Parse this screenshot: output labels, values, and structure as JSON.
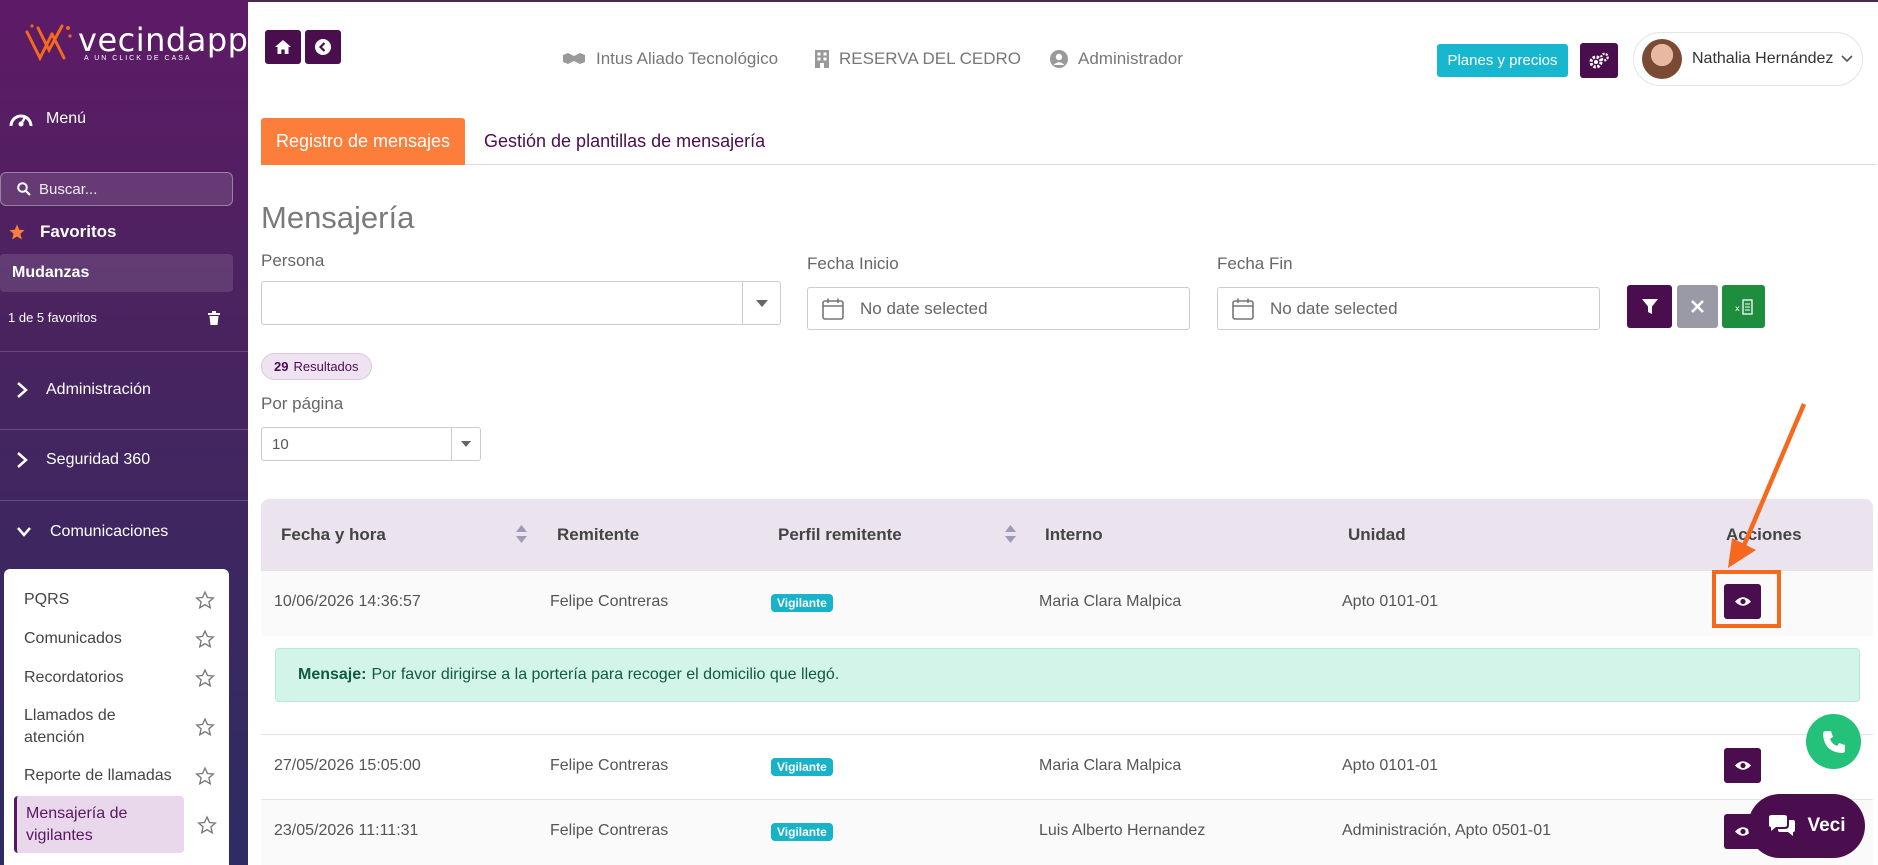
{
  "brand": {
    "name": "vecindapp",
    "tagline": "A UN CLICK DE CASA"
  },
  "colors": {
    "primary": "#4a0e4e",
    "accent_orange": "#fd7e3a",
    "cyan": "#17b8cf",
    "green": "#1e8e3e",
    "gray_btn": "#9a9aa6",
    "message_bg": "#d2f4e9"
  },
  "sidebar": {
    "menu_label": "Menú",
    "search_placeholder": "Buscar...",
    "favorites_title": "Favoritos",
    "favorite_item": "Mudanzas",
    "favorites_count": "1 de 5 favoritos",
    "sections": [
      {
        "label": "Administración",
        "icon": "chevron-right-icon"
      },
      {
        "label": "Seguridad 360",
        "icon": "chevron-right-icon"
      },
      {
        "label": "Comunicaciones",
        "icon": "chevron-down-icon"
      }
    ],
    "submenu": [
      {
        "label": "PQRS"
      },
      {
        "label": "Comunicados"
      },
      {
        "label": "Recordatorios"
      },
      {
        "label": "Llamados de",
        "label2": "atención"
      },
      {
        "label": "Reporte de llamadas"
      },
      {
        "label": "Mensajería de",
        "label2": "vigilantes",
        "active": true
      }
    ]
  },
  "header": {
    "company": "Intus Aliado Tecnológico",
    "property": "RESERVA DEL CEDRO",
    "role": "Administrador",
    "plans_button": "Planes y precios",
    "user_name": "Nathalia Hernández"
  },
  "tabs": [
    {
      "label": "Registro de mensajes",
      "active": true
    },
    {
      "label": "Gestión de plantillas de mensajería",
      "active": false
    }
  ],
  "page": {
    "title": "Mensajería",
    "filters": {
      "persona_label": "Persona",
      "persona_value": "",
      "fecha_inicio_label": "Fecha Inicio",
      "fecha_inicio_placeholder": "No date selected",
      "fecha_fin_label": "Fecha Fin",
      "fecha_fin_placeholder": "No date selected"
    },
    "results_count": "29",
    "results_label": "Resultados",
    "per_page_label": "Por página",
    "per_page_value": "10"
  },
  "table": {
    "headers": {
      "fecha": "Fecha y hora",
      "remitente": "Remitente",
      "perfil": "Perfil remitente",
      "interno": "Interno",
      "unidad": "Unidad",
      "acciones": "Acciones"
    },
    "rows": [
      {
        "fecha": "10/06/2026 14:36:57",
        "remitente": "Felipe Contreras",
        "perfil": "Vigilante",
        "interno": "Maria Clara Malpica",
        "unidad": "Apto 0101-01"
      },
      {
        "fecha": "27/05/2026 15:05:00",
        "remitente": "Felipe Contreras",
        "perfil": "Vigilante",
        "interno": "Maria Clara Malpica",
        "unidad": "Apto 0101-01"
      },
      {
        "fecha": "23/05/2026 11:11:31",
        "remitente": "Felipe Contreras",
        "perfil": "Vigilante",
        "interno": "Luis Alberto Hernandez",
        "unidad": "Administración, Apto 0501-01"
      }
    ],
    "expanded_message": {
      "label": "Mensaje:",
      "text": "Por favor dirigirse a la portería para recoger el domicilio que llegó."
    }
  },
  "chat": {
    "label": "Veci"
  }
}
